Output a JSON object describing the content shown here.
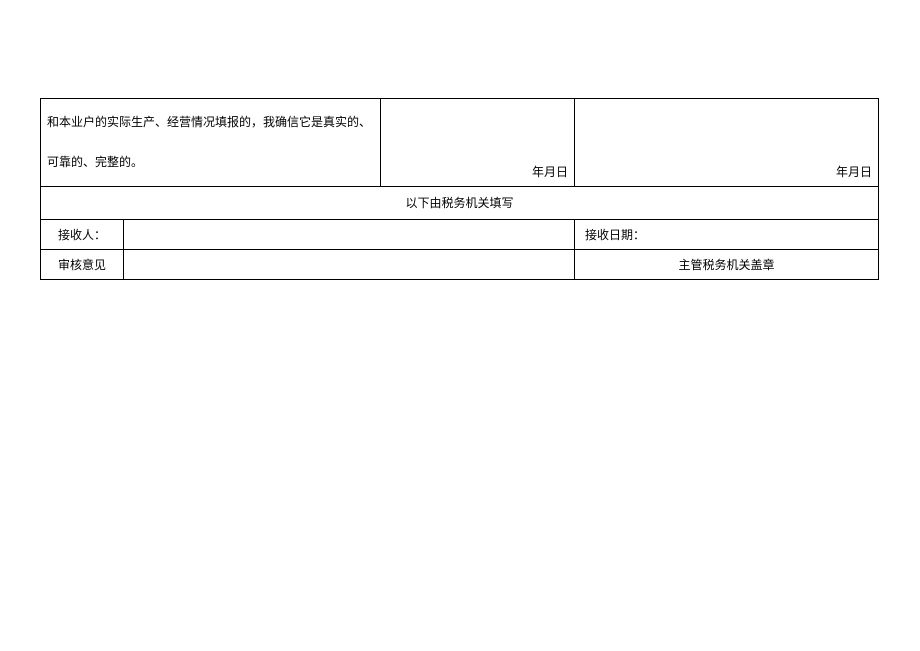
{
  "row1": {
    "declaration_line1": "和本业户的实际生产、经营情况填报的，我确信它是真实的、",
    "declaration_line2": "可靠的、完整的。",
    "date_label_1": "年月日",
    "date_label_2": "年月日"
  },
  "row2": {
    "heading": "以下由税务机关填写"
  },
  "row3": {
    "recipient_label": "接收人：",
    "recipient_value": "",
    "receive_date_label": "接收日期：",
    "receive_date_value": ""
  },
  "row4": {
    "opinion_label": "审核意见",
    "opinion_value": "",
    "stamp_label": "主管税务机关盖章"
  }
}
